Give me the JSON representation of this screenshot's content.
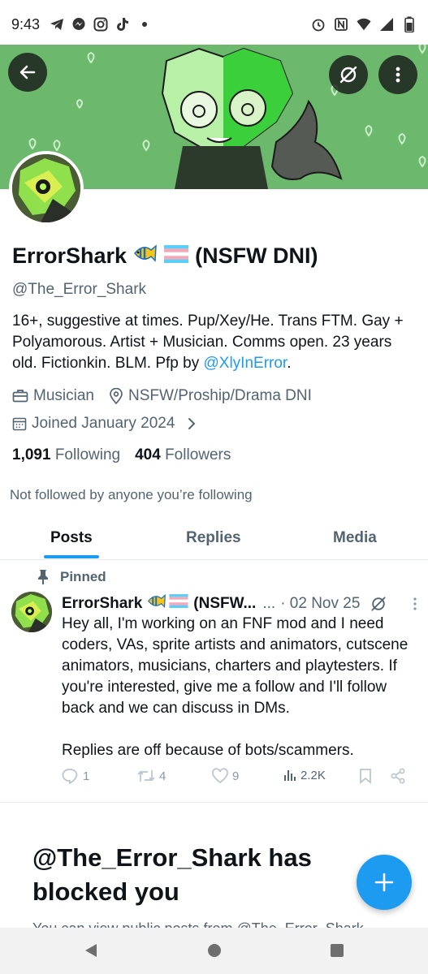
{
  "status_bar": {
    "time": "9:43",
    "left_icons": [
      "telegram-icon",
      "messenger-icon",
      "instagram-icon",
      "tiktok-icon",
      "dot-icon"
    ],
    "right_icons": [
      "alarm-icon",
      "nfc-icon",
      "wifi-icon",
      "signal-icon",
      "battery-icon"
    ]
  },
  "profile": {
    "display_name": "ErrorShark",
    "name_suffix": "(NSFW DNI)",
    "handle": "@The_Error_Shark",
    "bio_text": "16+, suggestive at times. Pup/Xey/He. Trans FTM. Gay + Polyamorous. Artist + Musician. Comms open. 23 years old. Fictionkin. BLM. Pfp by ",
    "bio_link": "@XlyInError",
    "bio_end": ".",
    "profession": "Musician",
    "location": "NSFW/Proship/Drama DNI",
    "joined": "Joined January 2024",
    "following_count": "1,091",
    "following_label": "Following",
    "followers_count": "404",
    "followers_label": "Followers",
    "not_followed": "Not followed by anyone you’re following"
  },
  "tabs": [
    {
      "label": "Posts",
      "active": true
    },
    {
      "label": "Replies",
      "active": false
    },
    {
      "label": "Media",
      "active": false
    }
  ],
  "post": {
    "pinned_label": "Pinned",
    "author": "ErrorShark",
    "author_suffix": "(NSFW...",
    "ellipsis": "...",
    "date": "· 02 Nov 25",
    "body_1": "Hey all, I'm working on an FNF mod and I need coders, VAs, sprite artists and animators, cutscene animators, musicians, charters and playtesters. If you're interested, give me a follow and I'll follow back and we can discuss in DMs.",
    "body_2": "Replies are off because of bots/scammers.",
    "replies": "1",
    "reposts": "4",
    "likes": "9",
    "views": "2.2K"
  },
  "blocked": {
    "title": "@The_Error_Shark has blocked you",
    "subtitle": "You can view public posts from @The_Error_Shark"
  },
  "colors": {
    "accent": "#1d9bf0",
    "secondary_text": "#536471",
    "banner_green": "#6ab86a"
  }
}
